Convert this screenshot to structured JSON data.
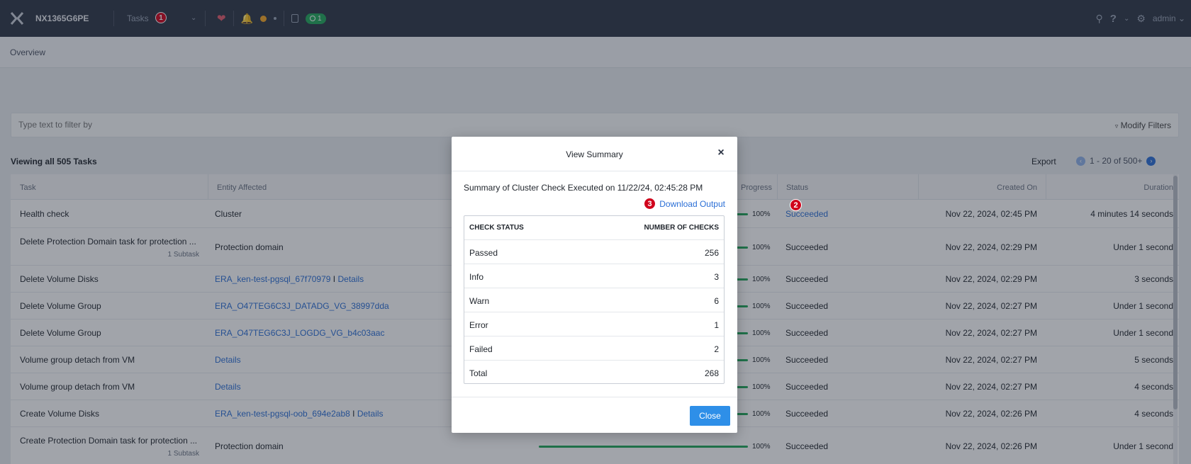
{
  "topbar": {
    "cluster_name": "NX1365G6PE",
    "tasks_label": "Tasks",
    "tasks_badge": "1",
    "task_count": "1",
    "user": "admin",
    "icons": [
      "nutanix-logo-icon",
      "heart-icon",
      "bell-icon",
      "clipboard-icon",
      "search-icon",
      "help-icon",
      "gear-icon"
    ]
  },
  "subheader": {
    "title": "Overview"
  },
  "filter": {
    "placeholder": "Type text to filter by",
    "modify_label": "Modify Filters"
  },
  "list": {
    "viewing": "Viewing all 505 Tasks",
    "export": "Export",
    "pager": "1 - 20 of 500+"
  },
  "columns": {
    "task": "Task",
    "entity": "Entity Affected",
    "progress": "Progress",
    "status": "Status",
    "created": "Created On",
    "duration": "Duration"
  },
  "rows": [
    {
      "task": "Health check",
      "subtask": "",
      "entity": "Cluster",
      "entity_link": "",
      "entity_details": "",
      "progress": 100,
      "progress_label": "100%",
      "status": "Succeeded",
      "created": "Nov 22, 2024, 02:45 PM",
      "duration": "4 minutes 14 seconds"
    },
    {
      "task": "Delete Protection Domain task for protection ...",
      "subtask": "1 Subtask",
      "entity": "Protection domain",
      "entity_link": "",
      "entity_details": "",
      "progress": 100,
      "progress_label": "100%",
      "status": "Succeeded",
      "created": "Nov 22, 2024, 02:29 PM",
      "duration": "Under 1 second"
    },
    {
      "task": "Delete Volume Disks",
      "subtask": "",
      "entity": "",
      "entity_link": "ERA_ken-test-pgsql_67f70979",
      "entity_details": "Details",
      "progress": 100,
      "progress_label": "100%",
      "status": "Succeeded",
      "created": "Nov 22, 2024, 02:29 PM",
      "duration": "3 seconds"
    },
    {
      "task": "Delete Volume Group",
      "subtask": "",
      "entity": "",
      "entity_link": "ERA_O47TEG6C3J_DATADG_VG_38997dda",
      "entity_details": "",
      "progress": 100,
      "progress_label": "100%",
      "status": "Succeeded",
      "created": "Nov 22, 2024, 02:27 PM",
      "duration": "Under 1 second"
    },
    {
      "task": "Delete Volume Group",
      "subtask": "",
      "entity": "",
      "entity_link": "ERA_O47TEG6C3J_LOGDG_VG_b4c03aac",
      "entity_details": "",
      "progress": 100,
      "progress_label": "100%",
      "status": "Succeeded",
      "created": "Nov 22, 2024, 02:27 PM",
      "duration": "Under 1 second"
    },
    {
      "task": "Volume group detach from VM",
      "subtask": "",
      "entity": "",
      "entity_link": "Details",
      "entity_details": "",
      "progress": 100,
      "progress_label": "100%",
      "status": "Succeeded",
      "created": "Nov 22, 2024, 02:27 PM",
      "duration": "5 seconds"
    },
    {
      "task": "Volume group detach from VM",
      "subtask": "",
      "entity": "",
      "entity_link": "Details",
      "entity_details": "",
      "progress": 100,
      "progress_label": "100%",
      "status": "Succeeded",
      "created": "Nov 22, 2024, 02:27 PM",
      "duration": "4 seconds"
    },
    {
      "task": "Create Volume Disks",
      "subtask": "",
      "entity": "",
      "entity_link": "ERA_ken-test-pgsql-oob_694e2ab8",
      "entity_details": "Details",
      "progress": 100,
      "progress_label": "100%",
      "status": "Succeeded",
      "created": "Nov 22, 2024, 02:26 PM",
      "duration": "4 seconds"
    },
    {
      "task": "Create Protection Domain task for protection ...",
      "subtask": "1 Subtask",
      "entity": "Protection domain",
      "entity_link": "",
      "entity_details": "",
      "progress": 100,
      "progress_label": "100%",
      "status": "Succeeded",
      "created": "Nov 22, 2024, 02:26 PM",
      "duration": "Under 1 second"
    }
  ],
  "modal": {
    "title": "View Summary",
    "summary": "Summary of Cluster Check Executed on 11/22/24, 02:45:28 PM",
    "download_label": "Download Output",
    "head_left": "CHECK STATUS",
    "head_right": "NUMBER OF CHECKS",
    "checks": [
      {
        "label": "Passed",
        "count": "256"
      },
      {
        "label": "Info",
        "count": "3"
      },
      {
        "label": "Warn",
        "count": "6"
      },
      {
        "label": "Error",
        "count": "1"
      },
      {
        "label": "Failed",
        "count": "2"
      },
      {
        "label": "Total",
        "count": "268"
      }
    ],
    "close_label": "Close"
  },
  "markers": [
    "1",
    "2",
    "3"
  ],
  "colors": {
    "topbar": "#2e3646",
    "link": "#2b6fd6",
    "success": "#22a85a",
    "marker": "#d0021b",
    "primary_button": "#2e8fe8"
  }
}
